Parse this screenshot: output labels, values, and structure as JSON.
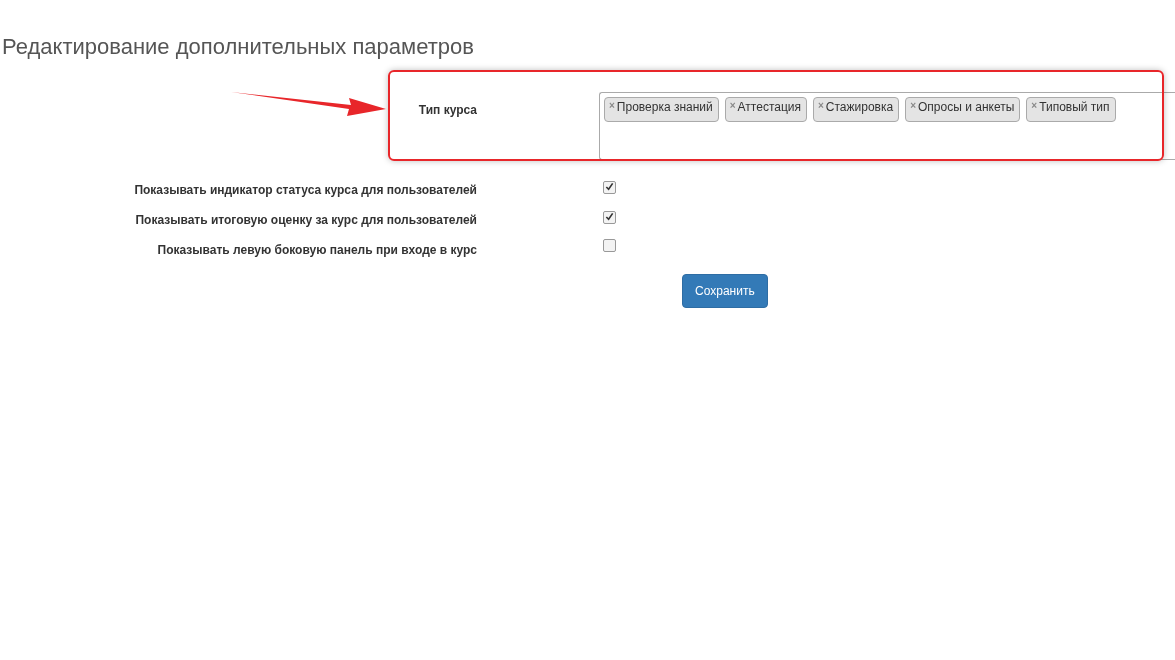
{
  "page_title": "Редактирование дополнительных параметров",
  "course_type": {
    "label": "Тип курса",
    "tags": [
      {
        "remove": "×",
        "text": "Проверка знаний"
      },
      {
        "remove": "×",
        "text": "Аттестация"
      },
      {
        "remove": "×",
        "text": "Стажировка"
      },
      {
        "remove": "×",
        "text": "Опросы и анкеты"
      },
      {
        "remove": "×",
        "text": "Типовый тип"
      }
    ]
  },
  "options": [
    {
      "label": "Показывать индикатор статуса курса для пользователей",
      "checked": true
    },
    {
      "label": "Показывать итоговую оценку за курс для пользователей",
      "checked": true
    },
    {
      "label": "Показывать левую боковую панель при входе в курс",
      "checked": false
    }
  ],
  "save_button": "Сохранить"
}
